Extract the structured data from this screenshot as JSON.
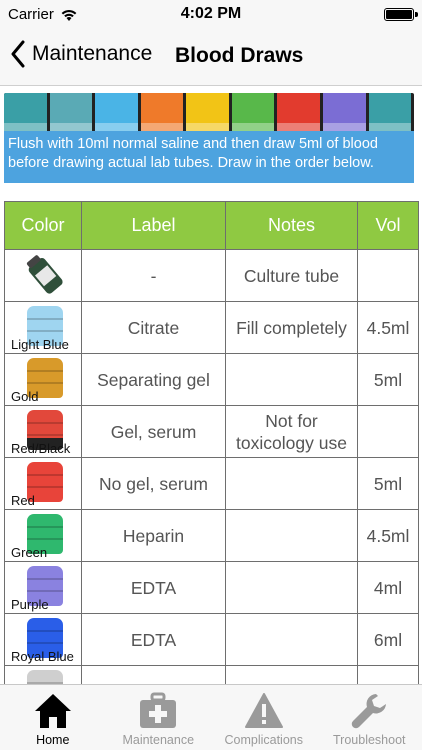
{
  "status_bar": {
    "carrier": "Carrier",
    "time": "4:02 PM"
  },
  "nav": {
    "back_label": "Maintenance",
    "title": "Blood Draws"
  },
  "banner": {
    "cap_colors": [
      "#3a9fa6",
      "#5aaab5",
      "#4ab4e6",
      "#ef7a2a",
      "#f2c416",
      "#58b84a",
      "#e23b2e",
      "#7b6dd4",
      "#3a9fa6"
    ]
  },
  "instructions": "Flush with 10ml normal saline and then draw 5ml of blood before drawing actual lab tubes. Draw in the order below.",
  "table": {
    "headers": {
      "color": "Color",
      "label": "Label",
      "notes": "Notes",
      "vol": "Vol"
    },
    "rows": [
      {
        "color_name": "",
        "icon": "culture-bottle-icon",
        "cap_color": "#2f4f3a",
        "label": "-",
        "notes": "Culture tube",
        "vol": ""
      },
      {
        "color_name": "Light Blue",
        "icon": "light-blue-cap-icon",
        "cap_color": "#9fd5f0",
        "label": "Citrate",
        "notes": "Fill completely",
        "vol": "4.5ml"
      },
      {
        "color_name": "Gold",
        "icon": "gold-cap-icon",
        "cap_color": "#d89a2a",
        "label": "Separating gel",
        "notes": "",
        "vol": "5ml"
      },
      {
        "color_name": "Red/Black",
        "icon": "red-black-cap-icon",
        "cap_color": "#e2483b",
        "label": "Gel, serum",
        "notes": "Not for toxicology use",
        "vol": ""
      },
      {
        "color_name": "Red",
        "icon": "red-cap-icon",
        "cap_color": "#e8443a",
        "label": "No gel, serum",
        "notes": "",
        "vol": "5ml"
      },
      {
        "color_name": "Green",
        "icon": "green-cap-icon",
        "cap_color": "#2fb86e",
        "label": "Heparin",
        "notes": "",
        "vol": "4.5ml"
      },
      {
        "color_name": "Purple",
        "icon": "purple-cap-icon",
        "cap_color": "#8a82e0",
        "label": "EDTA",
        "notes": "",
        "vol": "4ml"
      },
      {
        "color_name": "Royal Blue",
        "icon": "royal-blue-cap-icon",
        "cap_color": "#2a5ee8",
        "label": "EDTA",
        "notes": "",
        "vol": "6ml"
      },
      {
        "color_name": "",
        "icon": "gray-cap-icon",
        "cap_color": "#cfcfcf",
        "label": "",
        "notes": "",
        "vol": ""
      }
    ]
  },
  "tab_bar": {
    "tabs": [
      {
        "label": "Home",
        "icon": "home-icon",
        "active": true
      },
      {
        "label": "Maintenance",
        "icon": "medical-kit-icon",
        "active": false
      },
      {
        "label": "Complications",
        "icon": "warning-icon",
        "active": false
      },
      {
        "label": "Troubleshoot",
        "icon": "wrench-icon",
        "active": false
      }
    ],
    "active_color": "#000000",
    "inactive_color": "#9a9a9a"
  }
}
